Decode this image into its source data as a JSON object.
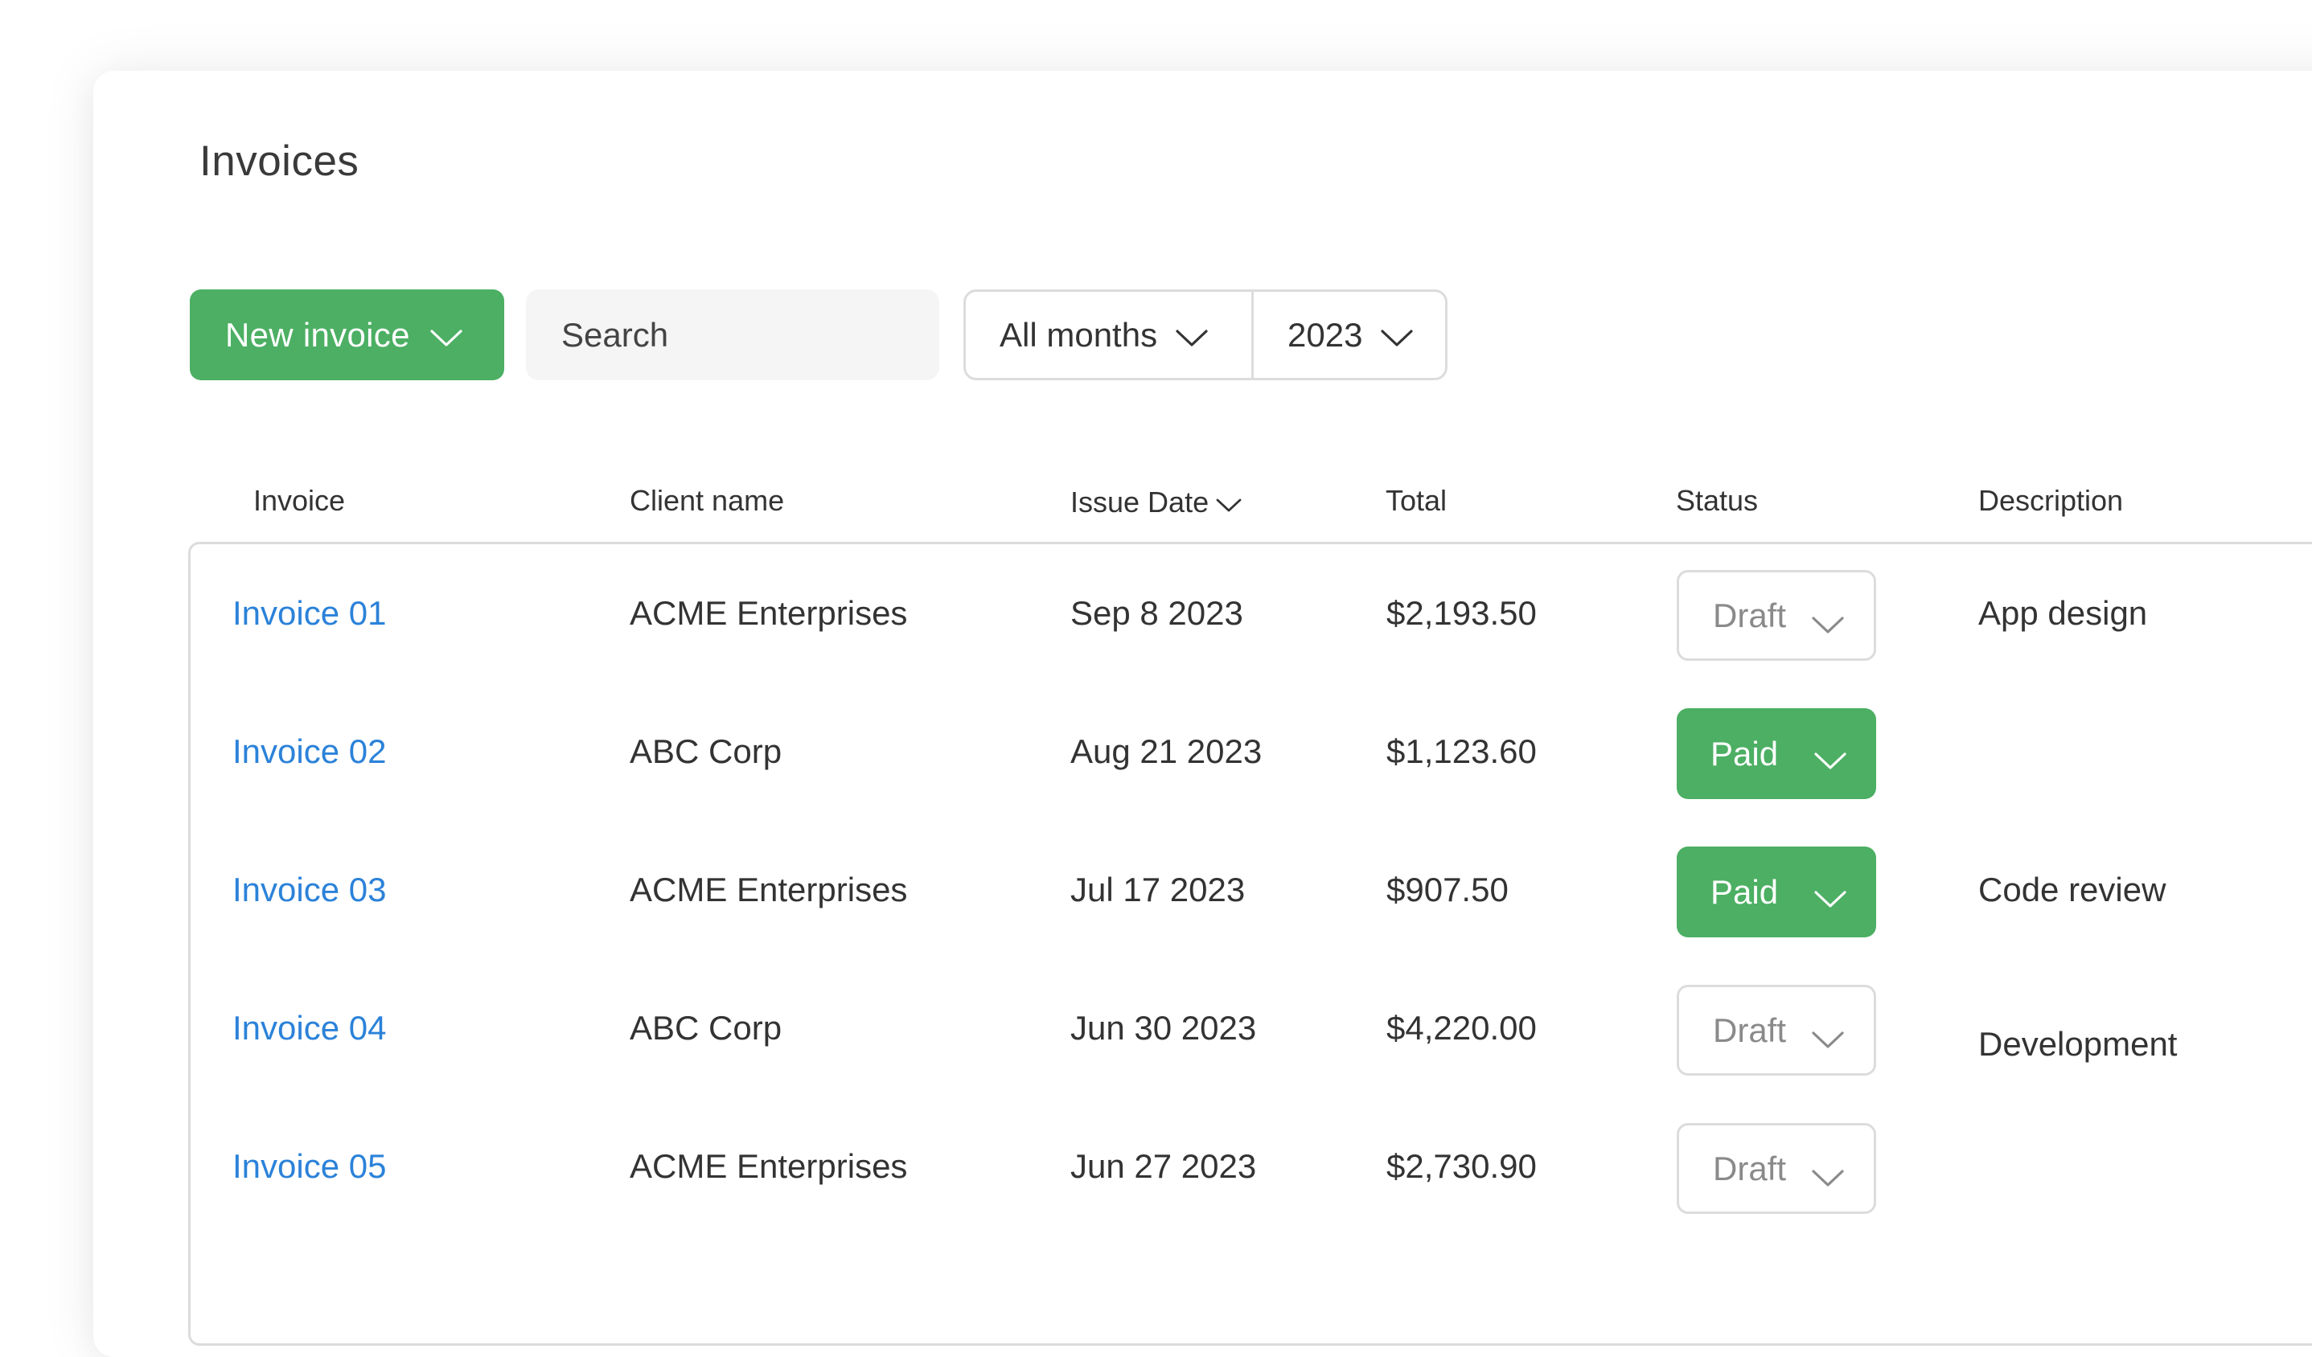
{
  "page": {
    "title": "Invoices"
  },
  "toolbar": {
    "new_invoice_label": "New invoice",
    "search_placeholder": "Search",
    "month_filter": "All months",
    "year_filter": "2023"
  },
  "table": {
    "headers": {
      "invoice": "Invoice",
      "client": "Client name",
      "date": "Issue Date",
      "total": "Total",
      "status": "Status",
      "description": "Description"
    },
    "rows": [
      {
        "invoice": "Invoice 01",
        "client": "ACME Enterprises",
        "date": "Sep 8 2023",
        "total": "$2,193.50",
        "status": "Draft",
        "description": "App design"
      },
      {
        "invoice": "Invoice 02",
        "client": "ABC Corp",
        "date": "Aug 21 2023",
        "total": "$1,123.60",
        "status": "Paid",
        "description": ""
      },
      {
        "invoice": "Invoice 03",
        "client": "ACME Enterprises",
        "date": "Jul 17 2023",
        "total": "$907.50",
        "status": "Paid",
        "description": "Code review"
      },
      {
        "invoice": "Invoice 04",
        "client": "ABC Corp",
        "date": "Jun 30 2023",
        "total": "$4,220.00",
        "status": "Draft",
        "description": "Development"
      },
      {
        "invoice": "Invoice 05",
        "client": "ACME Enterprises",
        "date": "Jun 27 2023",
        "total": "$2,730.90",
        "status": "Draft",
        "description": ""
      }
    ]
  },
  "colors": {
    "accent_green": "#4caf63",
    "link_blue": "#2b82d9",
    "border": "#dcdcdc",
    "draft_text": "#8a8a8a"
  },
  "icons": {
    "dropdown": "chevron-down-icon",
    "sort": "chevron-down-icon"
  }
}
